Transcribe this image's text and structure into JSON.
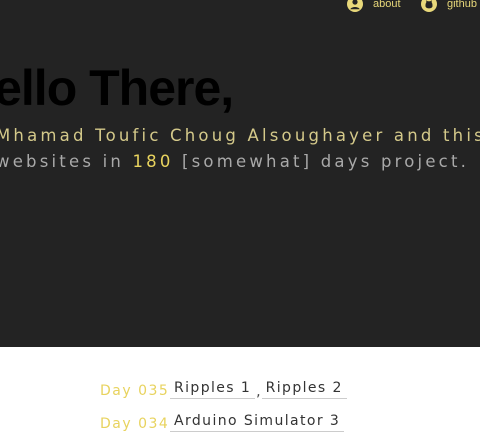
{
  "nav": {
    "about_label": "about",
    "github_label": "github",
    "about_icon": "user-circle-icon",
    "github_icon": "github-icon"
  },
  "hero": {
    "title": "Hello There,",
    "line1": "Mhamad Toufic Choug Alsoughayer and this is my",
    "line2_prefix": "websites in ",
    "line2_highlight": "180",
    "line2_suffix": " [somewhat] days project."
  },
  "projects": [
    {
      "day": "Day 035",
      "links": [
        "Ripples 1",
        "Ripples 2"
      ]
    },
    {
      "day": "Day 034",
      "links": [
        "Arduino Simulator 3"
      ]
    }
  ],
  "colors": {
    "hero_bg": "#232323",
    "accent": "#e8d35e",
    "muted_text": "#a9a9a9",
    "title": "#000000"
  }
}
